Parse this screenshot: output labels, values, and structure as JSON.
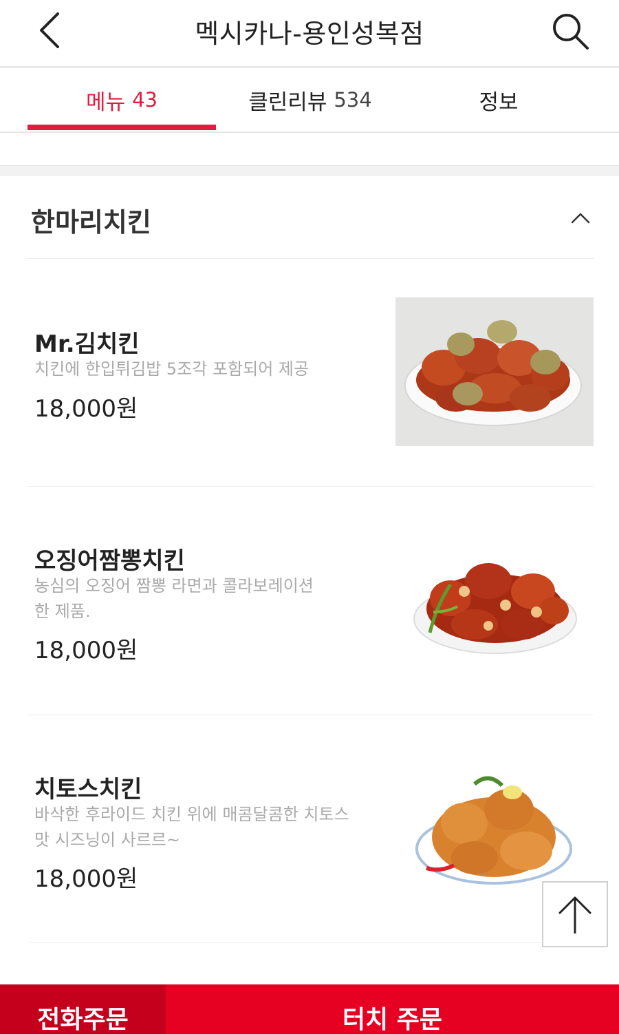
{
  "header": {
    "title": "멕시카나-용인성복점",
    "back_icon": "chevron-left-icon",
    "search_icon": "search-icon"
  },
  "tabs": [
    {
      "label": "메뉴",
      "count": "43",
      "active": true
    },
    {
      "label": "클린리뷰",
      "count": "534",
      "active": false
    },
    {
      "label": "정보",
      "count": "",
      "active": false
    }
  ],
  "category": {
    "title": "한마리치킨",
    "toggle_icon": "chevron-up-icon"
  },
  "menu_items": [
    {
      "name": "Mr.김치킨",
      "desc_lines": [
        "치킨에 한입튀김밥 5조각 포함되어 제공"
      ],
      "price": "18,000원"
    },
    {
      "name": "오징어짬뽕치킨",
      "desc_lines": [
        "농심의 오징어 짬뽕 라면과 콜라보레이션",
        "한 제품."
      ],
      "price": "18,000원"
    },
    {
      "name": "치토스치킨",
      "desc_lines": [
        "바삭한 후라이드 치킨 위에 매콤달콤한 치토스",
        "맛 시즈닝이 사르르~"
      ],
      "price": "18,000원"
    }
  ],
  "scroll_top_icon": "arrow-up-icon",
  "bottom_bar": {
    "phone_order": "전화주문",
    "touch_order": "터치 주문"
  },
  "colors": {
    "accent": "#e31b3f",
    "bottom_bar": "#e60022",
    "phone_order_bg": "#c4001c"
  }
}
